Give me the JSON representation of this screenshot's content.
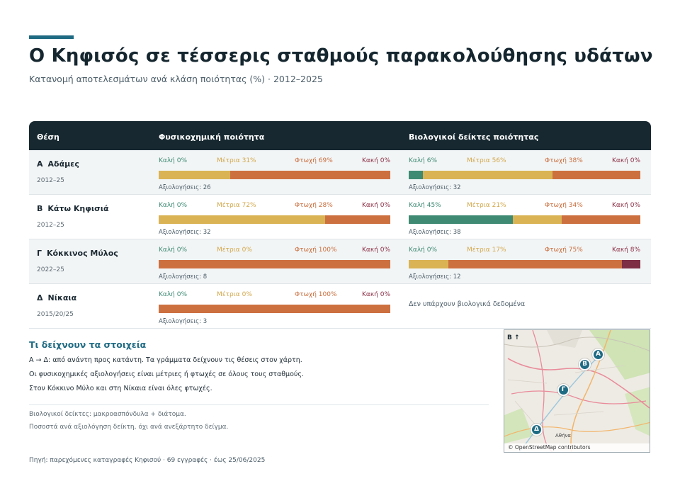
{
  "header": {
    "title": "Ο Κηφισός σε τέσσερις σταθμούς παρακολούθησης υδάτων",
    "subtitle": "Κατανομή αποτελεσμάτων ανά κλάση ποιότητας (%) · 2012–2025"
  },
  "colors": {
    "accent": "#1f6b84",
    "header_bg": "#172830",
    "good": "#3e8a73",
    "moderate": "#d9b354",
    "poor": "#cd7040",
    "bad": "#7d2d44"
  },
  "table": {
    "columns": [
      "Θέση",
      "Φυσικοχημική ποιότητα",
      "Βιολογικοί δείκτες ποιότητας"
    ],
    "no_bio_text": "Δεν υπάρχουν βιολογικά δεδομένα"
  },
  "chart_data": {
    "type": "bar",
    "stacked": true,
    "classes": [
      "Καλή",
      "Μέτρια",
      "Φτωχή",
      "Κακή"
    ],
    "sites": [
      {
        "letter": "Α",
        "name": "Αδάμες",
        "years": "2012–25",
        "phys": {
          "values": [
            0,
            31,
            69,
            0
          ],
          "labels": [
            "Καλή 0%",
            "Μέτρια 31%",
            "Φτωχή 69%",
            "Κακή 0%"
          ],
          "count": "Αξιολογήσεις: 26"
        },
        "bio": {
          "values": [
            6,
            56,
            38,
            0
          ],
          "labels": [
            "Καλή 6%",
            "Μέτρια 56%",
            "Φτωχή 38%",
            "Κακή 0%"
          ],
          "count": "Αξιολογήσεις: 32"
        }
      },
      {
        "letter": "Β",
        "name": "Κάτω Κηφισιά",
        "years": "2012–25",
        "phys": {
          "values": [
            0,
            72,
            28,
            0
          ],
          "labels": [
            "Καλή 0%",
            "Μέτρια 72%",
            "Φτωχή 28%",
            "Κακή 0%"
          ],
          "count": "Αξιολογήσεις: 32"
        },
        "bio": {
          "values": [
            45,
            21,
            34,
            0
          ],
          "labels": [
            "Καλή 45%",
            "Μέτρια 21%",
            "Φτωχή 34%",
            "Κακή 0%"
          ],
          "count": "Αξιολογήσεις: 38"
        }
      },
      {
        "letter": "Γ",
        "name": "Κόκκινος Μύλος",
        "years": "2022–25",
        "phys": {
          "values": [
            0,
            0,
            100,
            0
          ],
          "labels": [
            "Καλή 0%",
            "Μέτρια 0%",
            "Φτωχή 100%",
            "Κακή 0%"
          ],
          "count": "Αξιολογήσεις: 8"
        },
        "bio": {
          "values": [
            0,
            17,
            75,
            8
          ],
          "labels": [
            "Καλή 0%",
            "Μέτρια 17%",
            "Φτωχή 75%",
            "Κακή 8%"
          ],
          "count": "Αξιολογήσεις: 12"
        }
      },
      {
        "letter": "Δ",
        "name": "Νίκαια",
        "years": "2015/20/25",
        "phys": {
          "values": [
            0,
            0,
            100,
            0
          ],
          "labels": [
            "Καλή 0%",
            "Μέτρια 0%",
            "Φτωχή 100%",
            "Κακή 0%"
          ],
          "count": "Αξιολογήσεις: 3"
        },
        "bio": null
      }
    ]
  },
  "findings": {
    "title": "Τι δείχνουν τα στοιχεία",
    "lines": [
      "Α → Δ: από ανάντη προς κατάντη. Τα γράμματα δείχνουν τις θέσεις στον χάρτη.",
      "Οι φυσικοχημικές αξιολογήσεις είναι μέτριες ή φτωχές σε όλους τους σταθμούς.",
      "Στον Κόκκινο Μύλο και στη Νίκαια είναι όλες φτωχές."
    ],
    "notes": [
      "Βιολογικοί δείκτες: μακροασπόνδυλα + διάτομα.",
      "Ποσοστά ανά αξιολόγηση δείκτη, όχι ανά ανεξάρτητο δείγμα."
    ]
  },
  "source": "Πηγή: παρεχόμενες καταγραφές Κηφισού · 69 εγγραφές · έως 25/06/2025",
  "map": {
    "north_label": "Β ↑",
    "attribution": "© OpenStreetMap contributors",
    "city_label": "Αθήνα",
    "markers": [
      "Α",
      "Β",
      "Γ",
      "Δ"
    ]
  }
}
